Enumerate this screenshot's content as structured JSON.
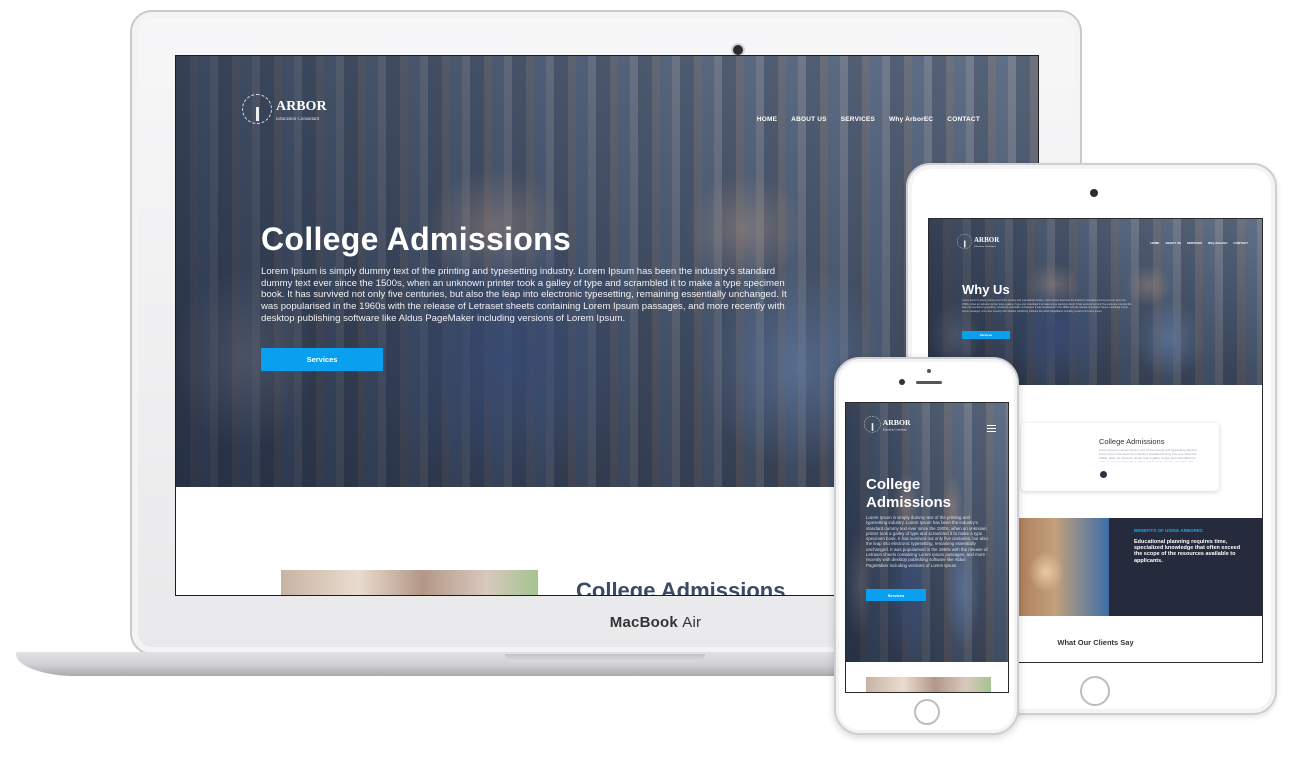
{
  "brand": {
    "name": "ARBOR",
    "tagline": "Education Consultant"
  },
  "mac": {
    "label_bold": "MacBook",
    "label_light": "Air",
    "nav": [
      "HOME",
      "ABOUT US",
      "SERVICES",
      "Why ArborEC",
      "CONTACT"
    ],
    "hero_title": "College Admissions",
    "hero_body": "Lorem Ipsum is simply dummy text of the printing and typesetting industry. Lorem Ipsum has been the industry's standard dummy text ever since the 1500s, when an unknown printer took a galley of type and scrambled it to make a type specimen book. It has survived not only five centuries, but also the leap into electronic typesetting, remaining essentially unchanged. It was popularised in the 1960s with the release of Letraset sheets containing Lorem Ipsum passages, and more recently with desktop publishing software like Aldus PageMaker including versions of Lorem Ipsum.",
    "hero_button": "Services",
    "section_title": "College Admissions"
  },
  "ipad": {
    "hero_title": "Why Us",
    "hero_button": "Services",
    "card_title": "College Admissions",
    "benefits_label": "BENEFITS OF USING ARBOREC",
    "benefits_headline": "Educational planning requires time, specialized knowledge that often exceed the scope of the resources available to applicants.",
    "clients_title": "What Our Clients Say"
  },
  "iphone": {
    "hero_title": "College Admissions",
    "hero_body": "Lorem Ipsum is simply dummy text of the printing and typesetting industry. Lorem Ipsum has been the industry's standard dummy text ever since the 1500s, when an unknown printer took a galley of type and scrambled it to make a type specimen book. It has survived not only five centuries, but also the leap into electronic typesetting, remaining essentially unchanged. It was popularised in the 1960s with the release of Letraset sheets containing Lorem Ipsum passages, and more recently with desktop publishing software like Aldus PageMaker including versions of Lorem Ipsum.",
    "hero_button": "Services"
  },
  "colors": {
    "accent": "#0aa0ef",
    "dark_panel": "#252b3c",
    "heading_blue": "#3b4a66"
  },
  "icons": [
    "arbor-tree-logo-icon",
    "hamburger-menu-icon"
  ]
}
